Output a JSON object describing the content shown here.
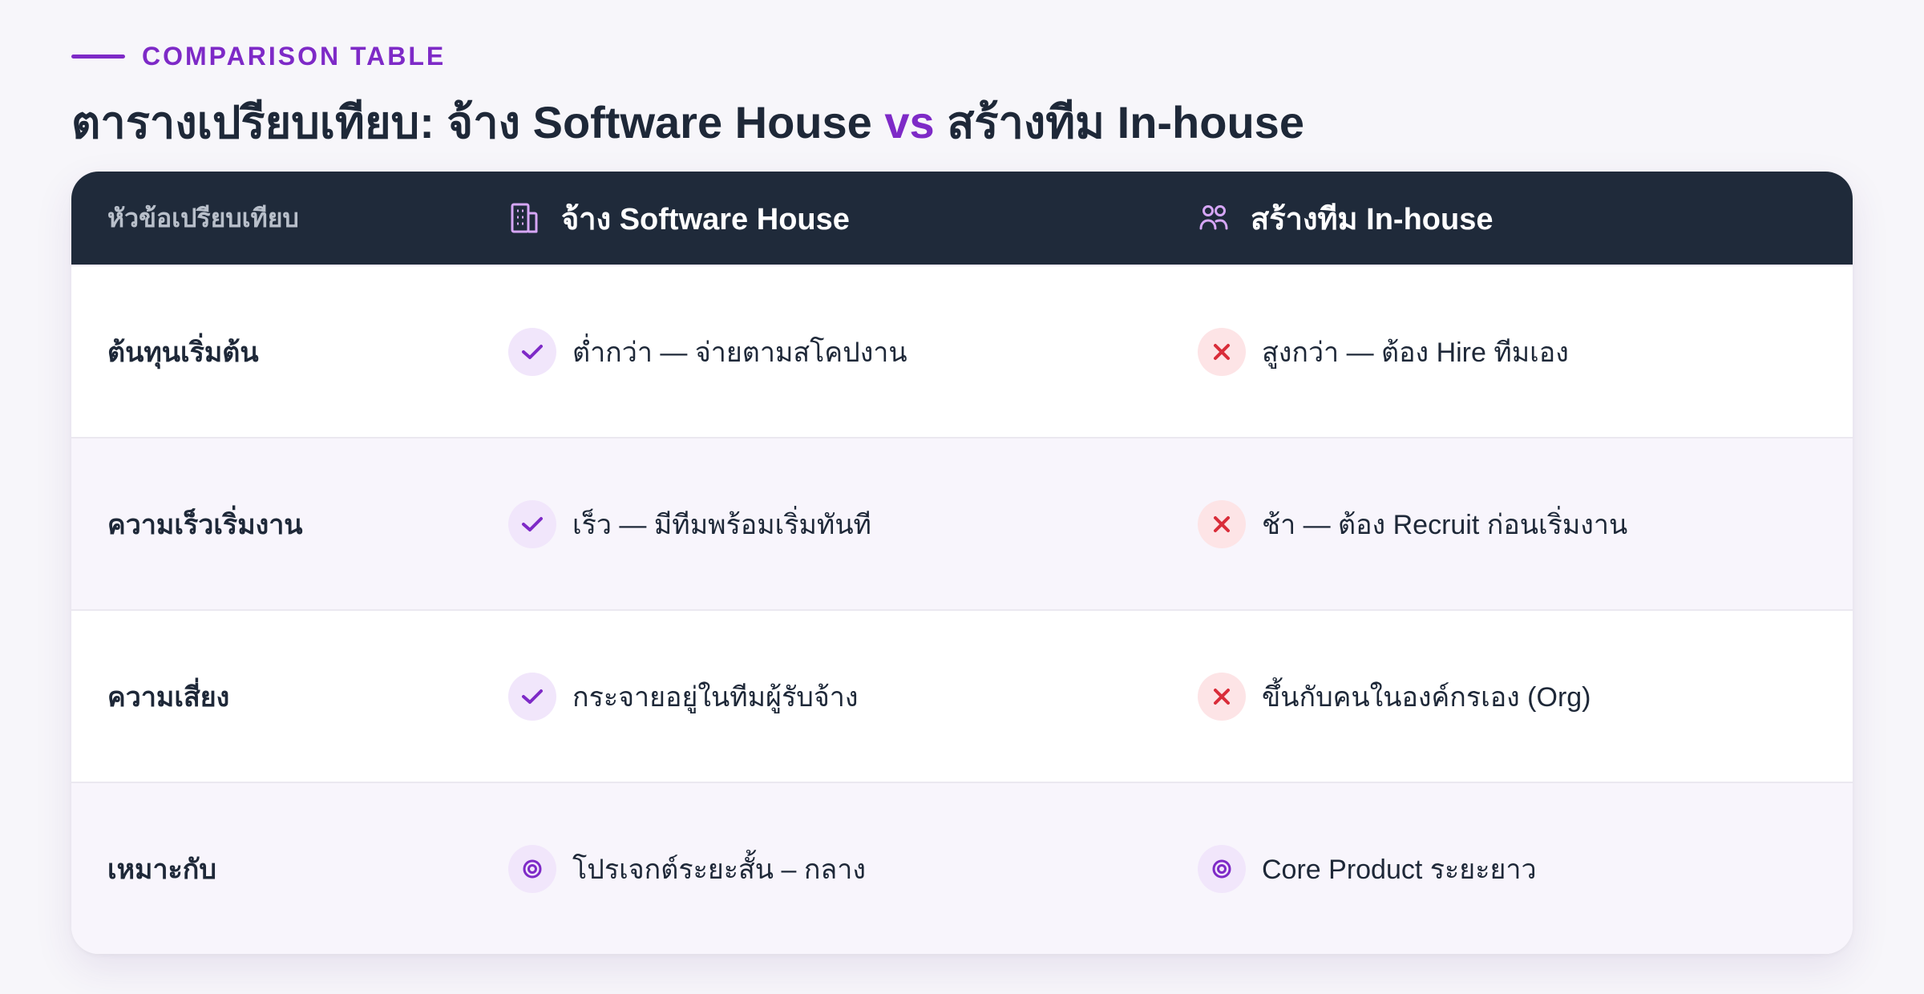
{
  "header": {
    "eyebrow": "COMPARISON TABLE",
    "title_part1": "ตารางเปรียบเทียบ: จ้าง Software House ",
    "title_vs": "vs",
    "title_part2": " สร้างทีม In-house"
  },
  "table": {
    "columns": [
      {
        "label": "หัวข้อเปรียบเทียบ",
        "icon": ""
      },
      {
        "label": "จ้าง Software House",
        "icon": "building-icon"
      },
      {
        "label": "สร้างทีม In-house",
        "icon": "users-icon"
      }
    ],
    "rows": [
      {
        "topic": "ต้นทุนเริ่มต้น",
        "software_house": {
          "text": "ต่ำกว่า — จ่ายตามสโคปงาน",
          "icon": "check-icon"
        },
        "in_house": {
          "text": "สูงกว่า — ต้อง Hire ทีมเอง",
          "icon": "cross-icon"
        }
      },
      {
        "topic": "ความเร็วเริ่มงาน",
        "software_house": {
          "text": "เร็ว — มีทีมพร้อมเริ่มทันที",
          "icon": "check-icon"
        },
        "in_house": {
          "text": "ช้า — ต้อง Recruit ก่อนเริ่มงาน",
          "icon": "cross-icon"
        }
      },
      {
        "topic": "ความเสี่ยง",
        "software_house": {
          "text": "กระจายอยู่ในทีมผู้รับจ้าง",
          "icon": "check-icon"
        },
        "in_house": {
          "text": "ขึ้นกับคนในองค์กรเอง (Org)",
          "icon": "cross-icon"
        }
      },
      {
        "topic": "เหมาะกับ",
        "software_house": {
          "text": "โปรเจกต์ระยะสั้น – กลาง",
          "icon": "target-icon"
        },
        "in_house": {
          "text": "Core Product ระยะยาว",
          "icon": "target-icon"
        }
      }
    ]
  },
  "colors": {
    "accent": "#7e2ac7",
    "header_bg": "#1f2a3a",
    "bad": "#d92d3a"
  }
}
